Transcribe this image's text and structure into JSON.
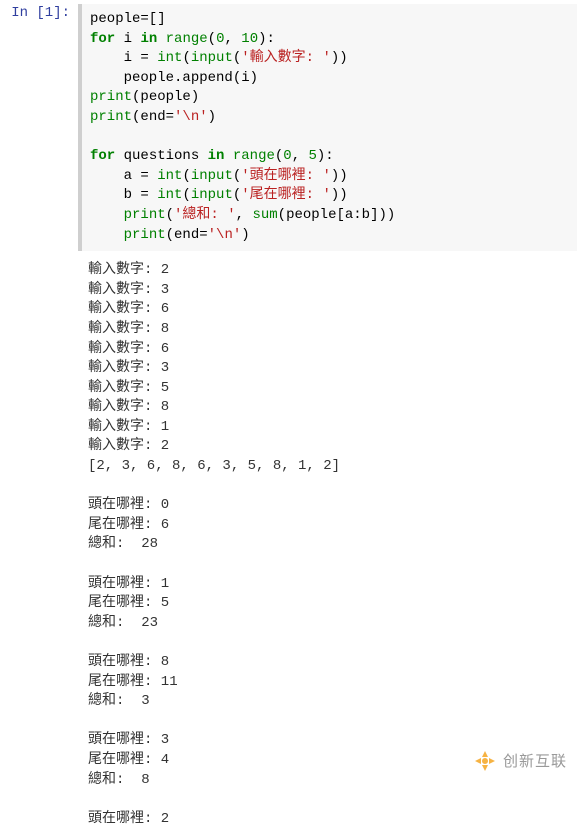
{
  "prompt": "In [1]:",
  "code": {
    "line1_a": "people=[]",
    "line2_for": "for",
    "line2_i": " i ",
    "line2_in": "in",
    "line2_sp": " ",
    "line2_range": "range",
    "line2_paren_open": "(",
    "line2_num0": "0",
    "line2_comma": ", ",
    "line2_num10": "10",
    "line2_close": "):",
    "line3_pre": "    i = ",
    "line3_int": "int",
    "line3_po": "(",
    "line3_input": "input",
    "line3_po2": "(",
    "line3_str": "'輸入數字: '",
    "line3_close": "))",
    "line4": "    people.append(i)",
    "line5_print": "print",
    "line5_rest": "(people)",
    "line6_print": "print",
    "line6_a": "(end=",
    "line6_str": "'\\n'",
    "line6_b": ")",
    "line8_for": "for",
    "line8_q": " questions ",
    "line8_in": "in",
    "line8_sp": " ",
    "line8_range": "range",
    "line8_po": "(",
    "line8_n0": "0",
    "line8_c": ", ",
    "line8_n5": "5",
    "line8_close": "):",
    "line9_pre": "    a = ",
    "line9_int": "int",
    "line9_po": "(",
    "line9_input": "input",
    "line9_po2": "(",
    "line9_str": "'頭在哪裡: '",
    "line9_close": "))",
    "line10_pre": "    b = ",
    "line10_int": "int",
    "line10_po": "(",
    "line10_input": "input",
    "line10_po2": "(",
    "line10_str": "'尾在哪裡: '",
    "line10_close": "))",
    "line11_pre": "    ",
    "line11_print": "print",
    "line11_po": "(",
    "line11_str": "'總和: '",
    "line11_c": ", ",
    "line11_sum": "sum",
    "line11_rest": "(people[a:b]))",
    "line12_pre": "    ",
    "line12_print": "print",
    "line12_a": "(end=",
    "line12_str": "'\\n'",
    "line12_b": ")"
  },
  "output": "輸入數字: 2\n輸入數字: 3\n輸入數字: 6\n輸入數字: 8\n輸入數字: 6\n輸入數字: 3\n輸入數字: 5\n輸入數字: 8\n輸入數字: 1\n輸入數字: 2\n[2, 3, 6, 8, 6, 3, 5, 8, 1, 2]\n\n頭在哪裡: 0\n尾在哪裡: 6\n總和:  28\n\n頭在哪裡: 1\n尾在哪裡: 5\n總和:  23\n\n頭在哪裡: 8\n尾在哪裡: 11\n總和:  3\n\n頭在哪裡: 3\n尾在哪裡: 4\n總和:  8\n\n頭在哪裡: 2",
  "watermark": "创新互联"
}
